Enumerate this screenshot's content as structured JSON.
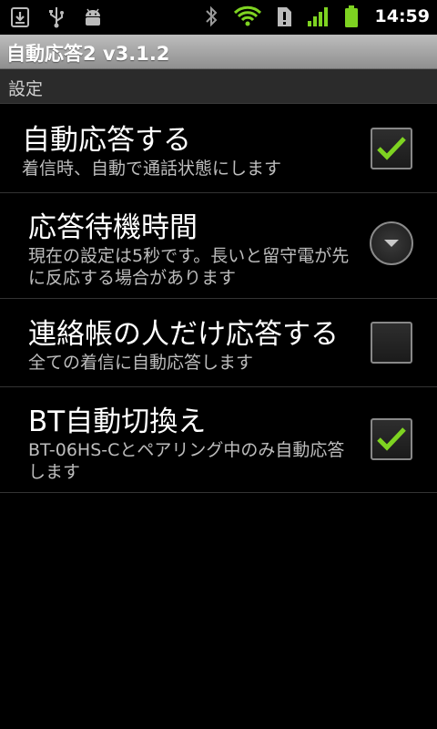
{
  "statusbar": {
    "left_icons": [
      "download-icon",
      "usb-icon",
      "android-debug-icon"
    ],
    "right_icons": [
      "bluetooth-icon",
      "wifi-icon",
      "alert-icon",
      "signal-icon",
      "battery-icon"
    ],
    "time": "14:59",
    "accent": "#7ed321"
  },
  "titlebar": {
    "title": "自動応答2 v3.1.2"
  },
  "category": {
    "label": "設定"
  },
  "prefs": [
    {
      "title": "自動応答する",
      "summary": "着信時、自動で通話状態にします",
      "checked": true
    },
    {
      "title": "応答待機時間",
      "summary": "現在の設定は5秒です。長いと留守電が先に反応する場合があります",
      "control": "dropdown"
    },
    {
      "title": "連絡帳の人だけ応答する",
      "summary": "全ての着信に自動応答します",
      "checked": false
    },
    {
      "title": "BT自動切換え",
      "summary": "BT-06HS-Cとペアリング中のみ自動応答します",
      "checked": true
    }
  ]
}
